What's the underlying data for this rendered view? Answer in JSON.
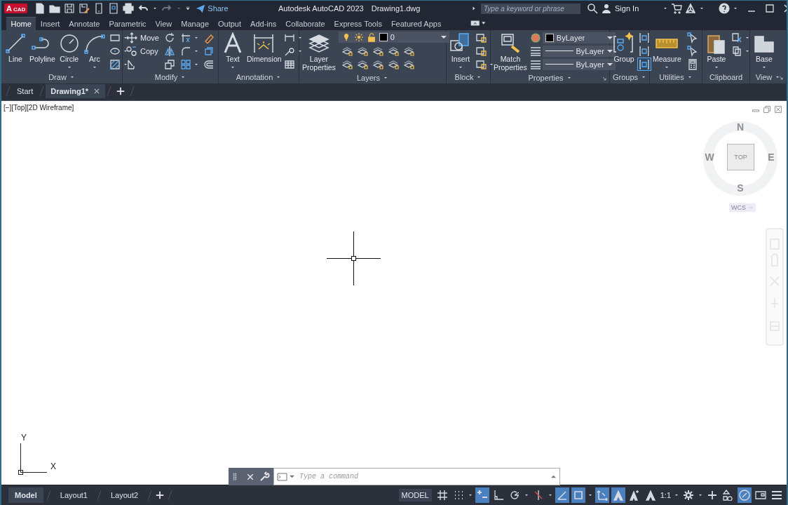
{
  "title_bar": {
    "app_logo": "A",
    "app_logo_suffix": "CAD",
    "share": "Share",
    "title": "Autodesk AutoCAD 2023",
    "file": "Drawing1.dwg",
    "search_placeholder": "Type a keyword or phrase",
    "sign_in": "Sign In"
  },
  "ribbon_tabs": [
    {
      "label": "Home",
      "selected": true
    },
    {
      "label": "Insert",
      "selected": false
    },
    {
      "label": "Annotate",
      "selected": false
    },
    {
      "label": "Parametric",
      "selected": false
    },
    {
      "label": "View",
      "selected": false
    },
    {
      "label": "Manage",
      "selected": false
    },
    {
      "label": "Output",
      "selected": false
    },
    {
      "label": "Add-ins",
      "selected": false
    },
    {
      "label": "Collaborate",
      "selected": false
    },
    {
      "label": "Express Tools",
      "selected": false
    },
    {
      "label": "Featured Apps",
      "selected": false
    }
  ],
  "panels": [
    {
      "title": "Draw",
      "has_menu": true,
      "columns": [
        [
          {
            "kind": "large",
            "label": "Line"
          }
        ],
        [
          {
            "kind": "large",
            "label": "Polyline"
          }
        ],
        [
          {
            "kind": "large",
            "label": "Circle",
            "has_menu": true
          }
        ],
        [
          {
            "kind": "large",
            "label": "Arc",
            "has_menu": true
          }
        ],
        [
          {
            "kind": "small",
            "has_menu": true
          },
          {
            "kind": "small",
            "has_menu": true
          },
          {
            "kind": "small",
            "has_menu": true
          }
        ]
      ]
    },
    {
      "title": "Modify",
      "has_menu": true,
      "columns": [
        [
          {
            "kind": "small",
            "label": "Move"
          },
          {
            "kind": "small",
            "label": "Copy"
          },
          {
            "kind": "small"
          }
        ],
        [
          {
            "kind": "small"
          },
          {
            "kind": "small"
          },
          {
            "kind": "small"
          }
        ],
        [
          {
            "kind": "small",
            "has_menu": true
          },
          {
            "kind": "small",
            "has_menu": true
          },
          {
            "kind": "small",
            "has_menu": true
          }
        ],
        [
          {
            "kind": "small"
          },
          {
            "kind": "small"
          },
          {
            "kind": "small"
          }
        ]
      ]
    },
    {
      "title": "Annotation",
      "has_menu": true,
      "columns": [
        [
          {
            "kind": "large",
            "label": "Text",
            "has_menu": true
          }
        ],
        [
          {
            "kind": "large",
            "label": "Dimension"
          }
        ],
        [
          {
            "kind": "small",
            "has_menu": true
          },
          {
            "kind": "small",
            "has_menu": true
          },
          {
            "kind": "small"
          }
        ]
      ]
    },
    {
      "title": "Layers",
      "has_menu": true,
      "columns": [
        [
          {
            "kind": "large",
            "label": "Layer Properties"
          }
        ],
        [
          {
            "kind": "layer-combo",
            "label": "0"
          },
          {
            "kind": "icon-strip"
          },
          {
            "kind": "icon-strip"
          }
        ]
      ]
    },
    {
      "title": "Block",
      "has_menu": true,
      "columns": [
        [
          {
            "kind": "large",
            "label": "Insert",
            "has_menu": true
          }
        ],
        [
          {
            "kind": "small"
          },
          {
            "kind": "small"
          },
          {
            "kind": "small",
            "has_menu": true
          }
        ]
      ]
    },
    {
      "title": "Properties",
      "has_menu": true,
      "launcher": true,
      "columns": [
        [
          {
            "kind": "large",
            "label": "Match Properties"
          }
        ],
        [
          {
            "kind": "color-combo",
            "label": "ByLayer"
          },
          {
            "kind": "line-combo",
            "label": "ByLayer"
          },
          {
            "kind": "line-combo",
            "label": "ByLayer"
          }
        ]
      ]
    },
    {
      "title": "Groups",
      "has_menu": true,
      "columns": [
        [
          {
            "kind": "large",
            "label": "Group"
          }
        ],
        [
          {
            "kind": "small",
            "on": false
          },
          {
            "kind": "small",
            "on": false
          },
          {
            "kind": "small",
            "on": true
          }
        ]
      ]
    },
    {
      "title": "Utilities",
      "has_menu": true,
      "columns": [
        [
          {
            "kind": "large",
            "label": "Measure",
            "has_menu": true
          }
        ],
        [
          {
            "kind": "small"
          },
          {
            "kind": "small"
          },
          {
            "kind": "small"
          }
        ]
      ]
    },
    {
      "title": "Clipboard",
      "columns": [
        [
          {
            "kind": "large",
            "label": "Paste",
            "has_menu": true
          }
        ],
        [
          {
            "kind": "small",
            "has_menu": true
          },
          {
            "kind": "small",
            "has_menu": true
          }
        ]
      ]
    },
    {
      "title": "View",
      "has_menu": true,
      "launcher": true,
      "columns": [
        [
          {
            "kind": "large",
            "label": "Base",
            "has_menu": true
          }
        ]
      ]
    }
  ],
  "file_tabs": [
    {
      "label": "Start",
      "selected": false
    },
    {
      "label": "Drawing1*",
      "selected": true,
      "closable": true
    }
  ],
  "viewport": {
    "label": "[−][Top][2D Wireframe]",
    "viewcube": {
      "north": "N",
      "west": "W",
      "east": "E",
      "south": "S",
      "face": "TOP",
      "ucs": "WCS"
    },
    "ucs_icon": {
      "y": "Y",
      "x": "X"
    },
    "command": {
      "placeholder": "Type a command"
    }
  },
  "layout_tabs": [
    {
      "label": "Model",
      "selected": true
    },
    {
      "label": "Layout1",
      "selected": false
    },
    {
      "label": "Layout2",
      "selected": false
    }
  ],
  "status_bar": {
    "model": "MODEL",
    "toggles": [
      {
        "on": false
      },
      {
        "on": false,
        "has_menu": true
      },
      {
        "on": true
      },
      {
        "on": false
      },
      {
        "on": false,
        "has_menu": true
      },
      {
        "on": false,
        "has_menu": true
      },
      {
        "on": true
      },
      {
        "on": true,
        "has_menu": true
      },
      {
        "on": true
      },
      {
        "on": true
      },
      {
        "on": false
      },
      {
        "on": false
      }
    ],
    "scale": "1:1",
    "tools": [
      {
        "on": false,
        "has_menu": true
      },
      {
        "on": false
      },
      {
        "on": false
      },
      {
        "on": true
      },
      {
        "on": false
      },
      {
        "on": false
      }
    ]
  }
}
